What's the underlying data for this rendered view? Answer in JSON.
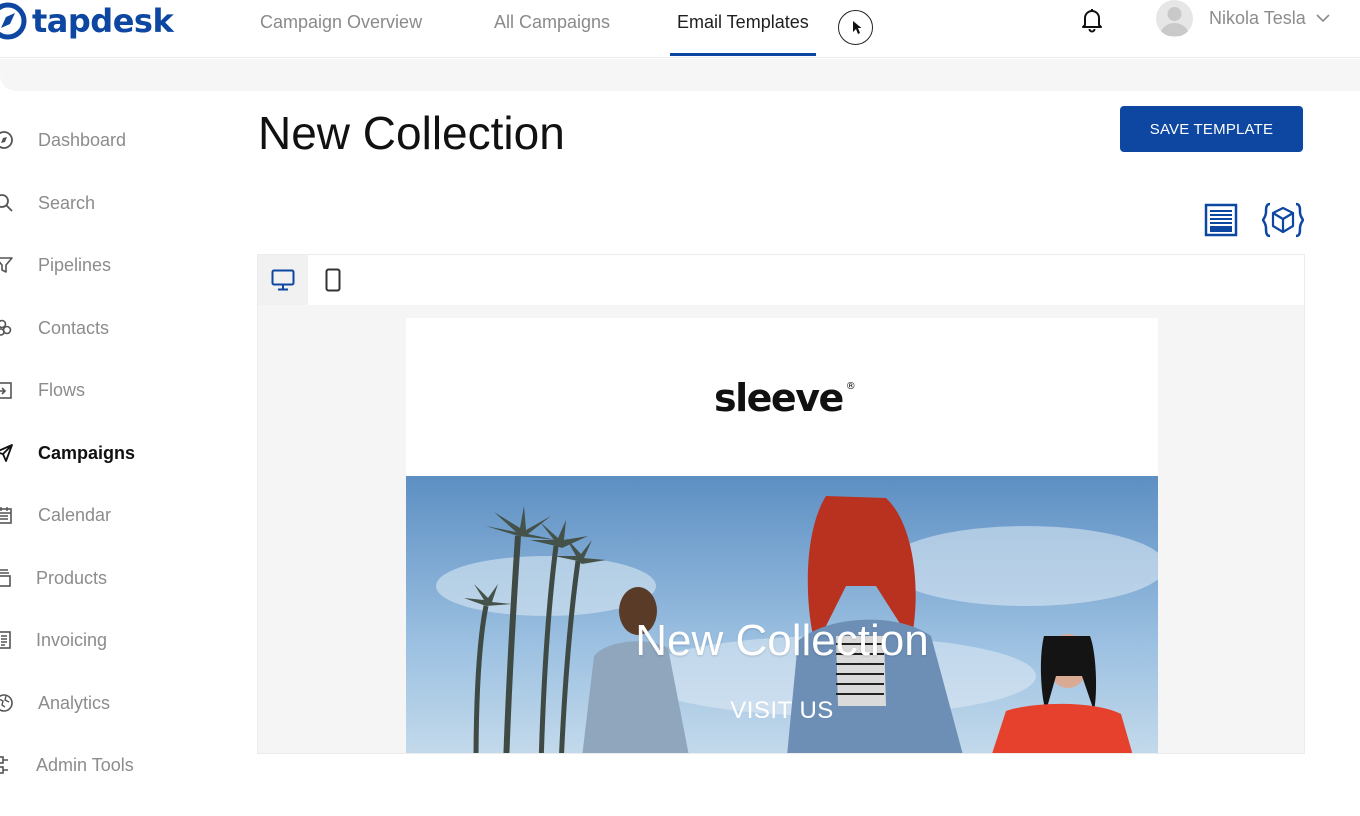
{
  "brand": {
    "name": "tapdesk",
    "accent": "#0d47a1"
  },
  "topnav": {
    "tabs": [
      {
        "label": "Campaign Overview"
      },
      {
        "label": "All Campaigns"
      },
      {
        "label": "Email Templates",
        "active": true
      }
    ]
  },
  "user": {
    "name": "Nikola Tesla"
  },
  "sidebar": {
    "items": [
      {
        "label": "Dashboard",
        "icon": "compass-icon"
      },
      {
        "label": "Search",
        "icon": "search-icon"
      },
      {
        "label": "Pipelines",
        "icon": "funnel-icon"
      },
      {
        "label": "Contacts",
        "icon": "contacts-icon"
      },
      {
        "label": "Flows",
        "icon": "flows-icon"
      },
      {
        "label": "Campaigns",
        "icon": "paper-plane-icon",
        "active": true
      },
      {
        "label": "Calendar",
        "icon": "calendar-icon"
      },
      {
        "label": "Products",
        "icon": "products-icon"
      },
      {
        "label": "Invoicing",
        "icon": "invoice-icon"
      },
      {
        "label": "Analytics",
        "icon": "globe-icon"
      },
      {
        "label": "Admin Tools",
        "icon": "admin-icon"
      }
    ]
  },
  "page": {
    "title": "New Collection",
    "save_label": "SAVE TEMPLATE"
  },
  "toolbar": {
    "layout_icon": "layout-icon",
    "code_icon": "code-block-icon"
  },
  "editor": {
    "devices": [
      {
        "icon": "desktop-icon",
        "active": true
      },
      {
        "icon": "mobile-icon"
      }
    ],
    "email": {
      "logo": "sleeve",
      "logo_mark": "®",
      "hero_title": "New Collection",
      "hero_cta": "VISIT US"
    },
    "block_tools_header": [
      "gear-icon",
      "copy-icon"
    ],
    "block_tools_hero": [
      "gear-icon",
      "copy-icon",
      "trash-icon"
    ]
  }
}
